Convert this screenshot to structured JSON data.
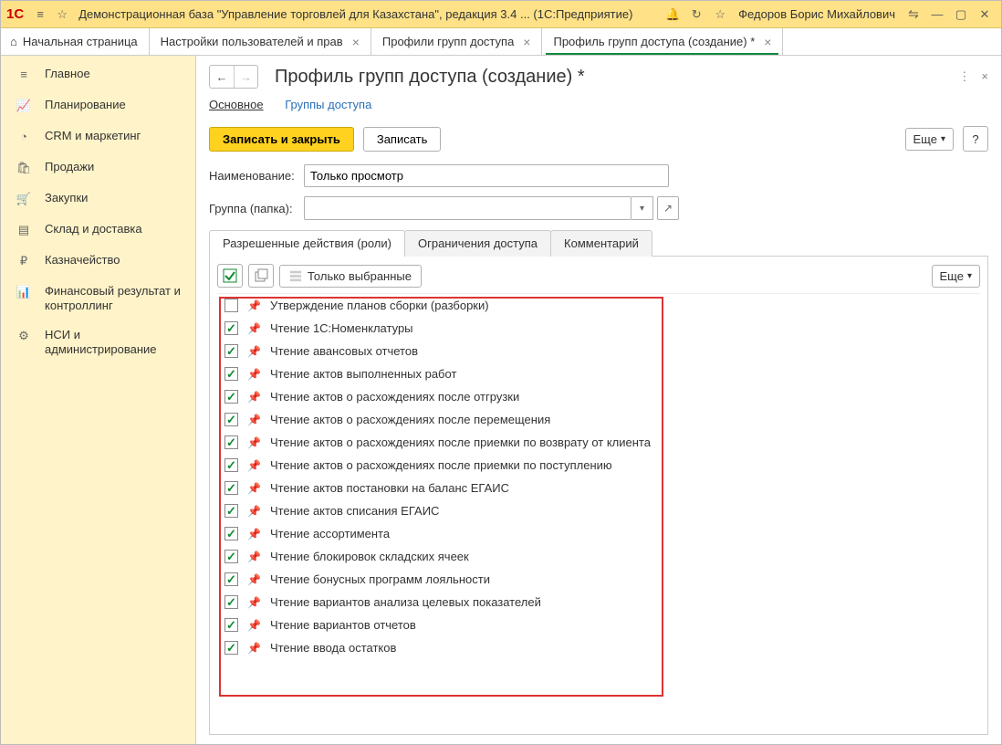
{
  "titlebar": {
    "logo": "1С",
    "title": "Демонстрационная база \"Управление торговлей для Казахстана\", редакция 3.4 ...  (1С:Предприятие)",
    "user": "Федоров Борис Михайлович"
  },
  "tabs": {
    "home": "Начальная страница",
    "t1": "Настройки пользователей и прав",
    "t2": "Профили групп доступа",
    "t3": "Профиль групп доступа (создание) *"
  },
  "sidebar": {
    "items": [
      {
        "label": "Главное"
      },
      {
        "label": "Планирование"
      },
      {
        "label": "CRM и маркетинг"
      },
      {
        "label": "Продажи"
      },
      {
        "label": "Закупки"
      },
      {
        "label": "Склад и доставка"
      },
      {
        "label": "Казначейство"
      },
      {
        "label": "Финансовый результат и контроллинг"
      },
      {
        "label": "НСИ и администрирование"
      }
    ]
  },
  "page": {
    "title": "Профиль групп доступа (создание) *",
    "subnav_main": "Основное",
    "subnav_groups": "Группы доступа",
    "btn_save_close": "Записать и закрыть",
    "btn_save": "Записать",
    "btn_more": "Еще",
    "lbl_name": "Наименование:",
    "val_name": "Только просмотр",
    "lbl_group": "Группа (папка):",
    "val_group": "",
    "subtab_roles": "Разрешенные действия (роли)",
    "subtab_restr": "Ограничения доступа",
    "subtab_comment": "Комментарий",
    "only_selected": "Только выбранные",
    "btn_more2": "Еще"
  },
  "roles": [
    {
      "checked": false,
      "label": "Утверждение планов сборки (разборки)"
    },
    {
      "checked": true,
      "label": "Чтение 1С:Номенклатуры"
    },
    {
      "checked": true,
      "label": "Чтение авансовых отчетов"
    },
    {
      "checked": true,
      "label": "Чтение актов выполненных работ"
    },
    {
      "checked": true,
      "label": "Чтение актов о расхождениях после отгрузки"
    },
    {
      "checked": true,
      "label": "Чтение актов о расхождениях после перемещения"
    },
    {
      "checked": true,
      "label": "Чтение актов о расхождениях после приемки по возврату от клиента"
    },
    {
      "checked": true,
      "label": "Чтение актов о расхождениях после приемки по поступлению"
    },
    {
      "checked": true,
      "label": "Чтение актов постановки на баланс ЕГАИС"
    },
    {
      "checked": true,
      "label": "Чтение актов списания ЕГАИС"
    },
    {
      "checked": true,
      "label": "Чтение ассортимента"
    },
    {
      "checked": true,
      "label": "Чтение блокировок складских ячеек"
    },
    {
      "checked": true,
      "label": "Чтение бонусных программ лояльности"
    },
    {
      "checked": true,
      "label": "Чтение вариантов анализа целевых показателей"
    },
    {
      "checked": true,
      "label": "Чтение вариантов отчетов"
    },
    {
      "checked": true,
      "label": "Чтение ввода остатков"
    }
  ]
}
